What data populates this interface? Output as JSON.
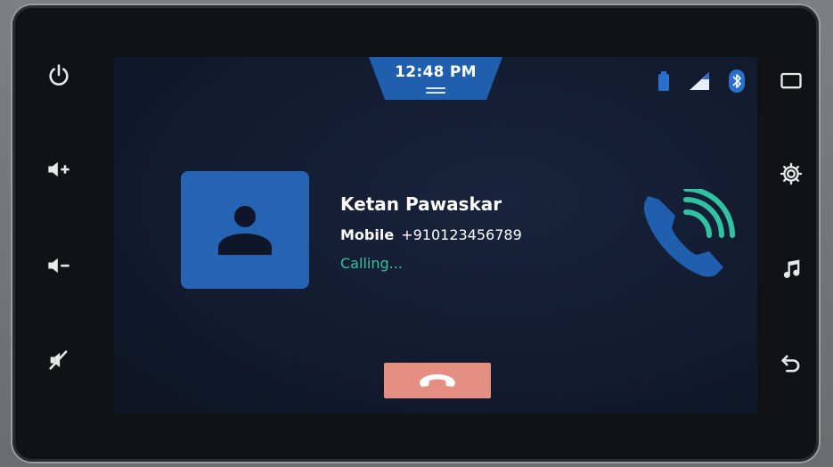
{
  "status_bar": {
    "time": "12:48 PM",
    "icons": [
      "battery-icon",
      "signal-icon",
      "bluetooth-icon"
    ]
  },
  "left_controls": [
    "power-icon",
    "volume-up-icon",
    "volume-down-icon",
    "mute-icon"
  ],
  "right_controls": [
    "home-screen-icon",
    "settings-icon",
    "music-icon",
    "back-icon"
  ],
  "call": {
    "contact_name": "Ketan Pawaskar",
    "number_label": "Mobile",
    "number": "+910123456789",
    "status": "Calling..."
  },
  "colors": {
    "accent": "#1f5fae",
    "status_green": "#2fc3a3",
    "end_call": "#e58f82"
  }
}
